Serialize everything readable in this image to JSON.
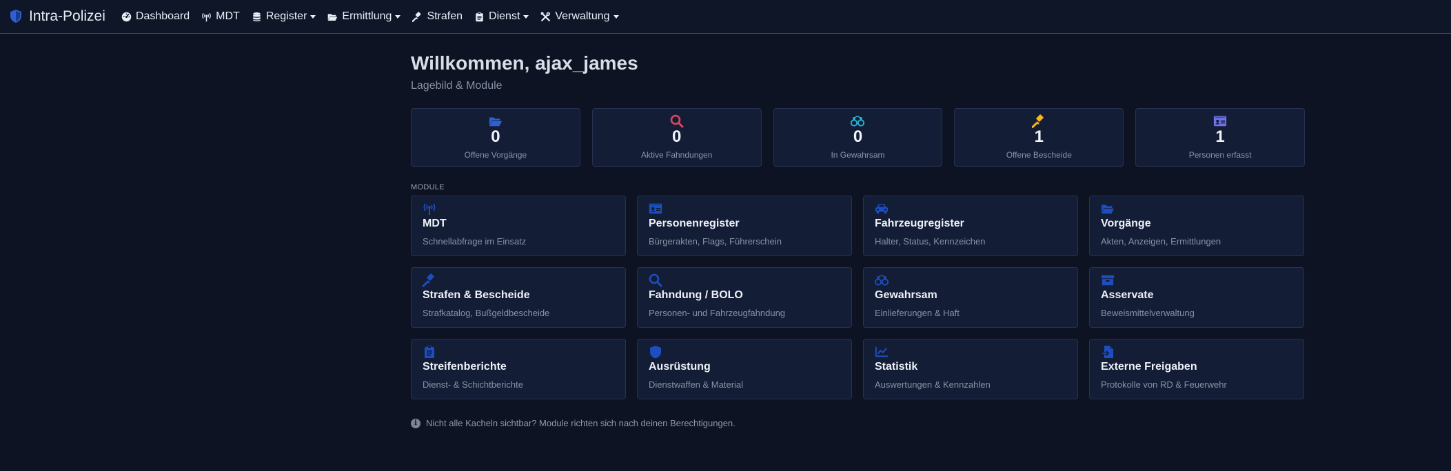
{
  "nav": {
    "brand": "Intra-Polizei",
    "items": [
      {
        "label": "Dashboard",
        "icon": "gauge-icon",
        "dropdown": false
      },
      {
        "label": "MDT",
        "icon": "antenna-icon",
        "dropdown": false
      },
      {
        "label": "Register",
        "icon": "database-icon",
        "dropdown": true
      },
      {
        "label": "Ermittlung",
        "icon": "folder-open-icon",
        "dropdown": true
      },
      {
        "label": "Strafen",
        "icon": "gavel-icon",
        "dropdown": false
      },
      {
        "label": "Dienst",
        "icon": "clipboard-icon",
        "dropdown": true
      },
      {
        "label": "Verwaltung",
        "icon": "tools-icon",
        "dropdown": true
      }
    ]
  },
  "header": {
    "title": "Willkommen, ajax_james",
    "subtitle": "Lagebild & Module"
  },
  "stats": [
    {
      "value": "0",
      "label": "Offene Vorgänge",
      "icon": "folder-open-icon",
      "color": "#2f5fd0"
    },
    {
      "value": "0",
      "label": "Aktive Fahndungen",
      "icon": "search-icon",
      "color": "#e0455a"
    },
    {
      "value": "0",
      "label": "In Gewahrsam",
      "icon": "handcuffs-icon",
      "color": "#2bb4d9"
    },
    {
      "value": "1",
      "label": "Offene Bescheide",
      "icon": "gavel-icon",
      "color": "#f5b820"
    },
    {
      "value": "1",
      "label": "Personen erfasst",
      "icon": "id-card-icon",
      "color": "#6f74e6"
    }
  ],
  "modules_label": "MODULE",
  "modules": [
    {
      "title": "MDT",
      "desc": "Schnellabfrage im Einsatz",
      "icon": "antenna-icon"
    },
    {
      "title": "Personenregister",
      "desc": "Bürgerakten, Flags, Führerschein",
      "icon": "id-card-icon"
    },
    {
      "title": "Fahrzeugregister",
      "desc": "Halter, Status, Kennzeichen",
      "icon": "car-icon"
    },
    {
      "title": "Vorgänge",
      "desc": "Akten, Anzeigen, Ermittlungen",
      "icon": "folder-open-icon"
    },
    {
      "title": "Strafen & Bescheide",
      "desc": "Strafkatalog, Bußgeldbescheide",
      "icon": "gavel-icon"
    },
    {
      "title": "Fahndung / BOLO",
      "desc": "Personen- und Fahrzeugfahndung",
      "icon": "search-icon"
    },
    {
      "title": "Gewahrsam",
      "desc": "Einlieferungen & Haft",
      "icon": "handcuffs-icon"
    },
    {
      "title": "Asservate",
      "desc": "Beweismittelverwaltung",
      "icon": "archive-box-icon"
    },
    {
      "title": "Streifenberichte",
      "desc": "Dienst- & Schichtberichte",
      "icon": "clipboard-icon"
    },
    {
      "title": "Ausrüstung",
      "desc": "Dienstwaffen & Material",
      "icon": "shield-icon"
    },
    {
      "title": "Statistik",
      "desc": "Auswertungen & Kennzahlen",
      "icon": "chart-line-icon"
    },
    {
      "title": "Externe Freigaben",
      "desc": "Protokolle von RD & Feuerwehr",
      "icon": "file-import-icon"
    }
  ],
  "footer_note": "Nicht alle Kacheln sichtbar? Module richten sich nach deinen Berechtigungen.",
  "colors": {
    "accent": "#1f4f9e",
    "module_icon": "#1d4ec0",
    "background": "#0d1322",
    "card": "#141d36"
  }
}
